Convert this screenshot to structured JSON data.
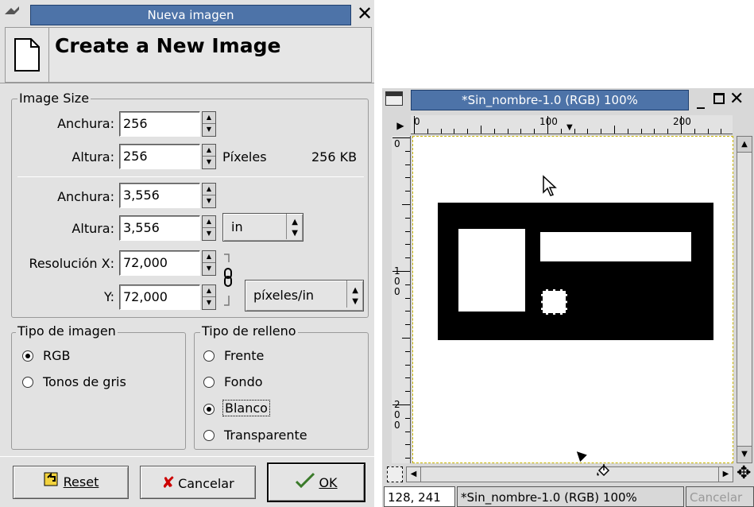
{
  "dialog": {
    "title": "Nueva imagen",
    "header": "Create a New Image",
    "image_size": {
      "legend": "Image Size",
      "width_label": "Anchura:",
      "width_value": "256",
      "height_label": "Altura:",
      "height_value": "256",
      "unit_label": "Píxeles",
      "size_text": "256 KB"
    },
    "print_size": {
      "width_label": "Anchura:",
      "width_value": "3,556",
      "height_label": "Altura:",
      "height_value": "3,556",
      "unit_select": "in",
      "res_x_label": "Resolución X:",
      "res_x_value": "72,000",
      "res_y_label": "Y:",
      "res_y_value": "72,000",
      "res_unit_select": "píxeles/in"
    },
    "image_type": {
      "legend": "Tipo de imagen",
      "options": [
        "RGB",
        "Tonos de gris"
      ],
      "selected": "RGB"
    },
    "fill_type": {
      "legend": "Tipo de relleno",
      "options": [
        "Frente",
        "Fondo",
        "Blanco",
        "Transparente"
      ],
      "selected": "Blanco"
    },
    "buttons": {
      "reset": "Reset",
      "cancel": "Cancelar",
      "ok": "OK"
    }
  },
  "image_window": {
    "title": "*Sin_nombre-1.0 (RGB) 100%",
    "ruler_h": [
      "0",
      "100",
      "200"
    ],
    "ruler_v": [
      "0",
      "100",
      "200"
    ],
    "status": {
      "coords": "128, 241",
      "name": "*Sin_nombre-1.0 (RGB) 100%",
      "cancel": "Cancelar"
    }
  },
  "colors": {
    "titlebar": "#4d73a8",
    "dialog_bg": "#e2e2e2",
    "canvas_black": "#000000"
  }
}
